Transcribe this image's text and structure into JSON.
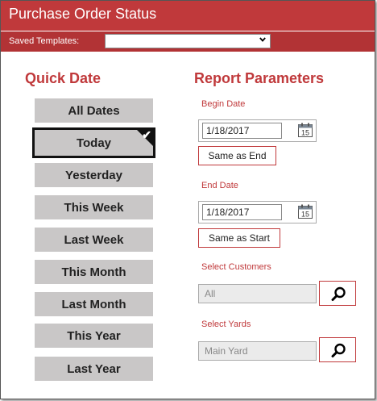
{
  "window": {
    "title": "Purchase Order Status"
  },
  "templates": {
    "label": "Saved Templates:",
    "selected": ""
  },
  "quick_date": {
    "title": "Quick Date",
    "buttons": [
      "All Dates",
      "Today",
      "Yesterday",
      "This Week",
      "Last Week",
      "This Month",
      "Last Month",
      "This Year",
      "Last Year"
    ],
    "selected": "Today"
  },
  "report": {
    "title": "Report Parameters",
    "begin_date": {
      "label": "Begin Date",
      "value": "1/18/2017",
      "calendar_day": "15",
      "same_button": "Same as End"
    },
    "end_date": {
      "label": "End Date",
      "value": "1/18/2017",
      "calendar_day": "15",
      "same_button": "Same as Start"
    },
    "customers": {
      "label": "Select Customers",
      "value": "All"
    },
    "yards": {
      "label": "Select Yards",
      "value": "Main Yard"
    }
  },
  "colors": {
    "accent": "#c0393b",
    "accent_dark": "#b23335",
    "button_gray": "#c9c7c7"
  }
}
